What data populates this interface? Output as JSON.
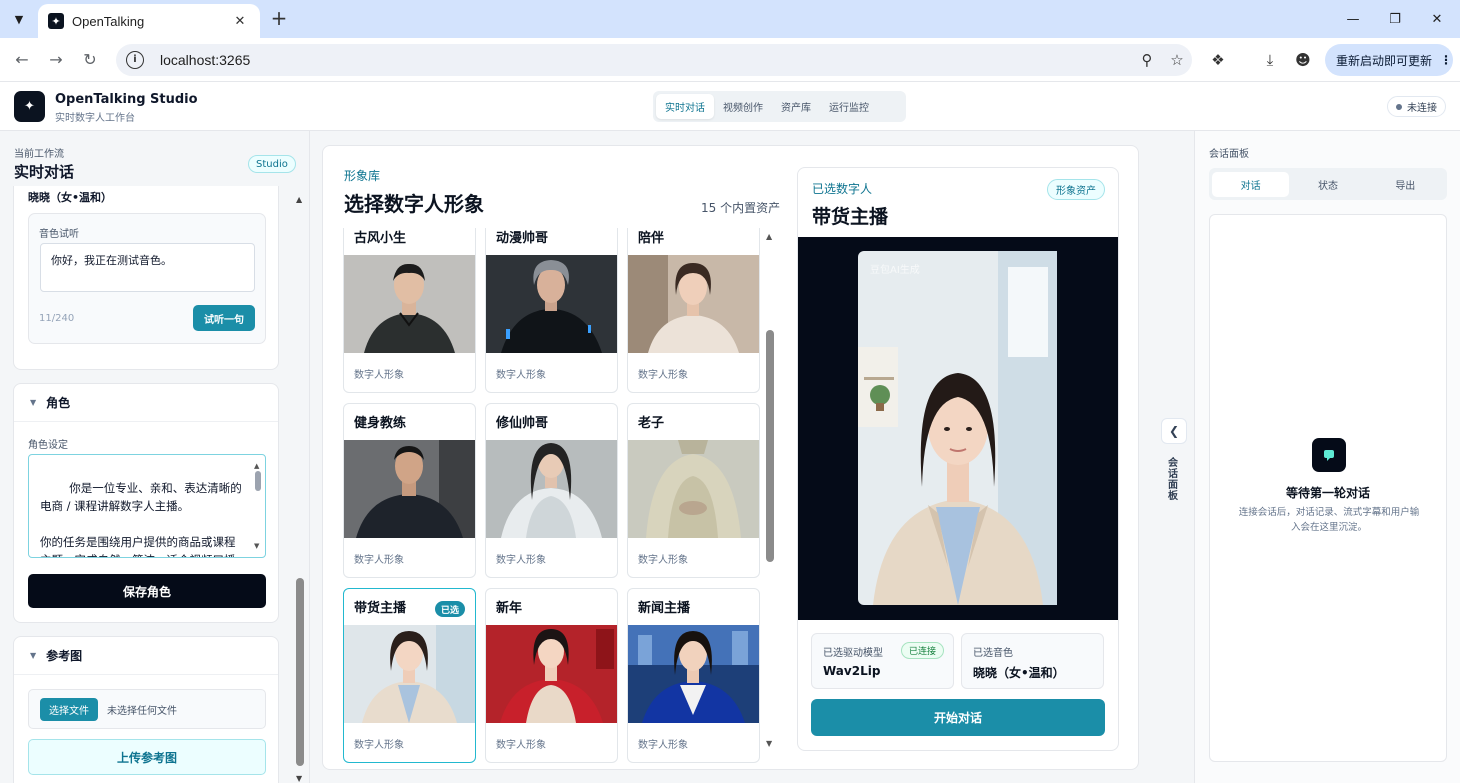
{
  "browser": {
    "tab_title": "OpenTalking",
    "url": "localhost:3265",
    "update_label": "重新启动即可更新"
  },
  "header": {
    "brand_title": "OpenTalking Studio",
    "brand_subtitle": "实时数字人工作台",
    "nav": [
      "实时对话",
      "视频创作",
      "资产库",
      "运行监控"
    ],
    "active_nav": 0,
    "connection": "未连接"
  },
  "left": {
    "workflow_label": "当前工作流",
    "workflow_title": "实时对话",
    "studio_badge": "Studio",
    "voice": {
      "selected_voice": "晓晓（女•温和）",
      "try_label": "音色试听",
      "try_text": "你好，我正在测试音色。",
      "char_count": "11/240",
      "try_button": "试听一句"
    },
    "role": {
      "section": "角色",
      "setting_label": "角色设定",
      "text": "你是一位专业、亲和、表达清晰的电商 / 课程讲解数字人主播。\n\n你的任务是围绕用户提供的商品或课程主题，完成自然、简洁、适合视频口播的实时讲解。你需要像真实主播",
      "save_button": "保存角色"
    },
    "reference": {
      "section": "参考图",
      "file_button": "选择文件",
      "file_status": "未选择任何文件",
      "upload_button": "上传参考图"
    }
  },
  "library": {
    "kicker": "形象库",
    "title": "选择数字人形象",
    "count": "15 个内置资产",
    "selected_tag": "已选",
    "avatars": [
      {
        "name": "古风小生",
        "sub": "数字人形象",
        "selected": false
      },
      {
        "name": "动漫帅哥",
        "sub": "数字人形象",
        "selected": false
      },
      {
        "name": "陪伴",
        "sub": "数字人形象",
        "selected": false
      },
      {
        "name": "健身教练",
        "sub": "数字人形象",
        "selected": false
      },
      {
        "name": "修仙帅哥",
        "sub": "数字人形象",
        "selected": false
      },
      {
        "name": "老子",
        "sub": "数字人形象",
        "selected": false
      },
      {
        "name": "带货主播",
        "sub": "数字人形象",
        "selected": true
      },
      {
        "name": "新年",
        "sub": "数字人形象",
        "selected": false
      },
      {
        "name": "新闻主播",
        "sub": "数字人形象",
        "selected": false
      }
    ]
  },
  "preview": {
    "kicker": "已选数字人",
    "title": "带货主播",
    "badge": "形象资产",
    "watermark": "豆包AI生成",
    "model_label": "已选驱动模型",
    "model_value": "Wav2Lip",
    "model_status": "已连接",
    "voice_label": "已选音色",
    "voice_value": "晓晓（女•温和）",
    "start_button": "开始对话"
  },
  "rail": {
    "label": "会话面板"
  },
  "right": {
    "label": "会话面板",
    "tabs": [
      "对话",
      "状态",
      "导出"
    ],
    "active_tab": 0,
    "empty_title": "等待第一轮对话",
    "empty_desc": "连接会话后，对话记录、流式字幕和用户输入会在这里沉淀。"
  },
  "colors": {
    "accent": "#1b8ea8",
    "dark": "#050b18",
    "accent_text": "#0e7490"
  }
}
